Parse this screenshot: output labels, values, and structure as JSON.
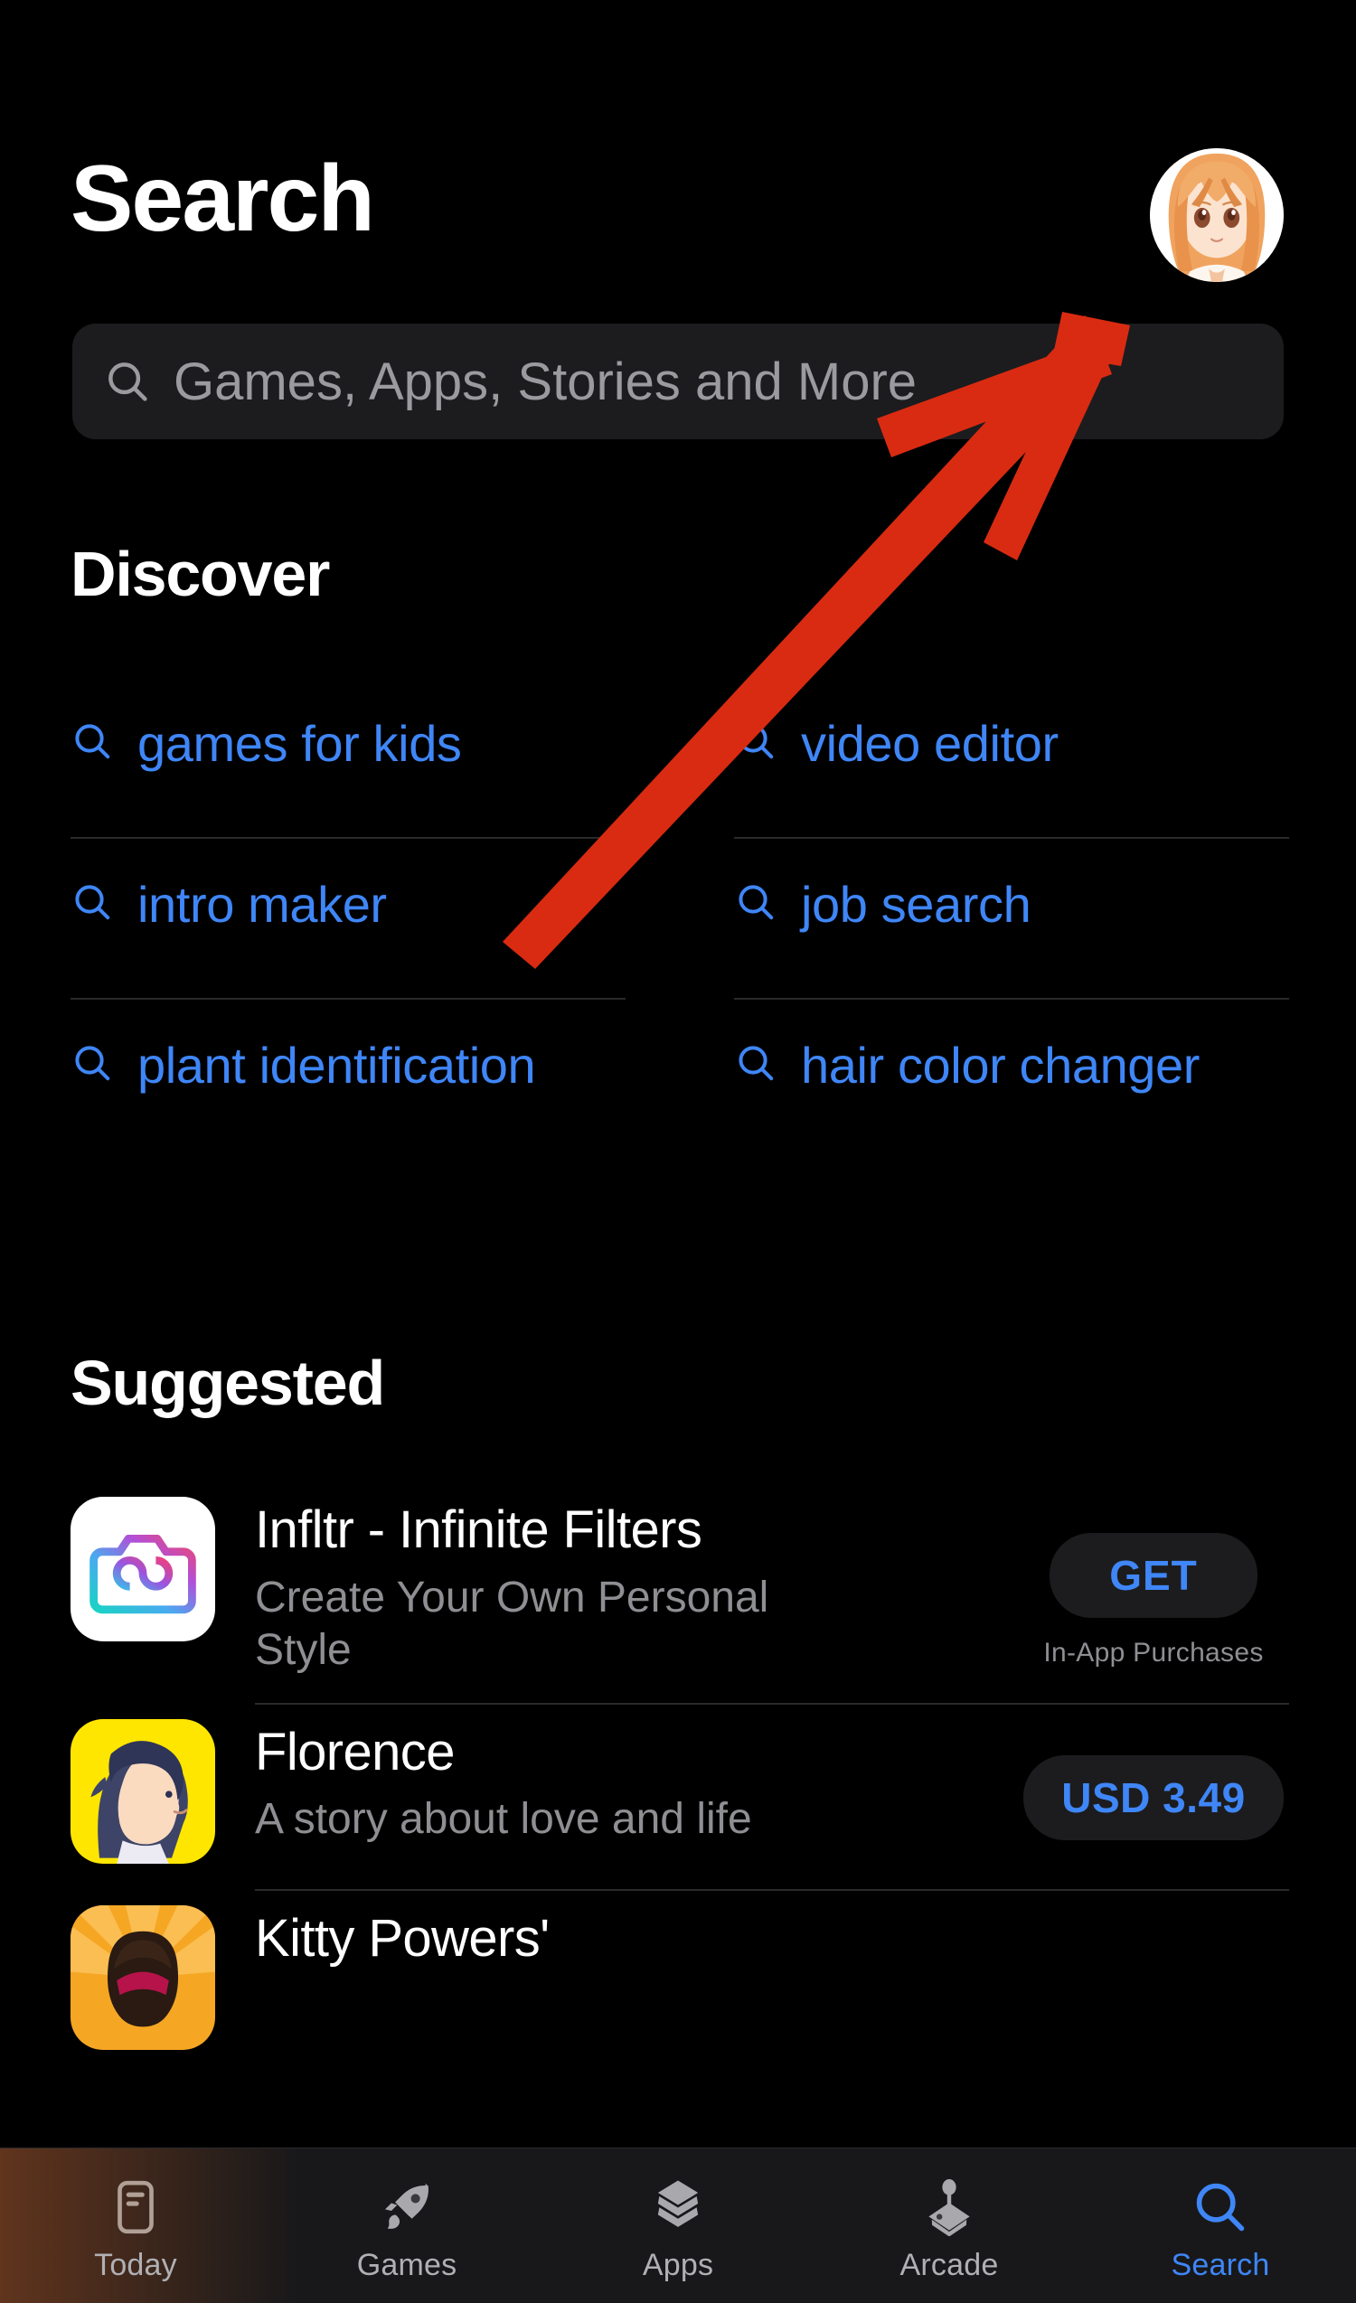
{
  "header": {
    "title": "Search",
    "avatar_name": "user-avatar",
    "avatar_description": "anime character with orange hair"
  },
  "search": {
    "placeholder": "Games, Apps, Stories and More",
    "value": "",
    "icon": "search-icon"
  },
  "discover": {
    "title": "Discover",
    "icon": "search-icon",
    "items": [
      {
        "label": "games for kids"
      },
      {
        "label": "video editor"
      },
      {
        "label": "intro maker"
      },
      {
        "label": "job search"
      },
      {
        "label": "plant identification"
      },
      {
        "label": "hair color changer"
      }
    ]
  },
  "suggested": {
    "title": "Suggested",
    "apps": [
      {
        "name": "Infltr - Infinite Filters",
        "subtitle": "Create Your Own Personal Style",
        "action_label": "GET",
        "note": "In-App Purchases",
        "icon": "camera-infinity-icon"
      },
      {
        "name": "Florence",
        "subtitle": "A story about love and life",
        "action_label": "USD 3.49",
        "note": "",
        "icon": "girl-portrait-icon"
      },
      {
        "name": "Kitty Powers'",
        "subtitle": "",
        "action_label": "",
        "note": "",
        "icon": "kitty-powers-icon"
      }
    ]
  },
  "tabbar": {
    "tabs": [
      {
        "label": "Today",
        "icon": "today-card-icon",
        "active": false
      },
      {
        "label": "Games",
        "icon": "rocket-icon",
        "active": false
      },
      {
        "label": "Apps",
        "icon": "stacked-layers-icon",
        "active": false
      },
      {
        "label": "Arcade",
        "icon": "joystick-icon",
        "active": false
      },
      {
        "label": "Search",
        "icon": "search-icon",
        "active": true
      }
    ]
  },
  "annotation": {
    "type": "arrow",
    "color": "#d92b12",
    "points_to": "search-input"
  },
  "colors": {
    "background": "#000000",
    "accent_blue": "#3f86f7",
    "field_background": "#1c1c1e",
    "secondary_text": "#8e8e93",
    "separator": "#2a2a2c",
    "annotation_red": "#d92b12"
  }
}
